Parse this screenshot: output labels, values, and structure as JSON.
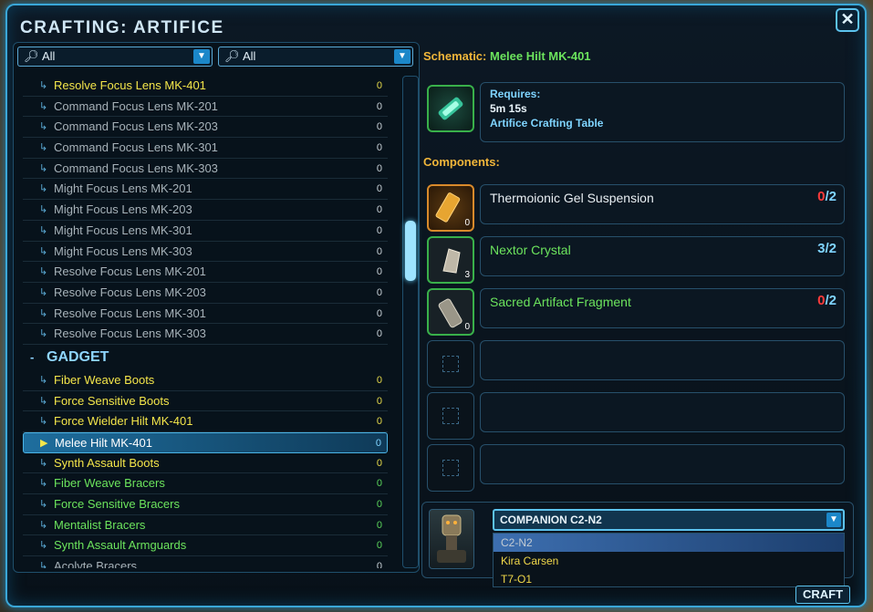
{
  "window": {
    "title": "CRAFTING: ARTIFICE",
    "close_label": "✕"
  },
  "filters": [
    {
      "value": "All",
      "icon": "search-icon"
    },
    {
      "value": "All",
      "icon": "search-icon"
    }
  ],
  "list_items": [
    {
      "label": "Resolve Focus Lens MK-401",
      "count": "0",
      "color": "yellow"
    },
    {
      "label": "Command Focus Lens MK-201",
      "count": "0",
      "color": "gray"
    },
    {
      "label": "Command Focus Lens MK-203",
      "count": "0",
      "color": "gray"
    },
    {
      "label": "Command Focus Lens MK-301",
      "count": "0",
      "color": "gray"
    },
    {
      "label": "Command Focus Lens MK-303",
      "count": "0",
      "color": "gray"
    },
    {
      "label": "Might Focus Lens MK-201",
      "count": "0",
      "color": "gray"
    },
    {
      "label": "Might Focus Lens MK-203",
      "count": "0",
      "color": "gray"
    },
    {
      "label": "Might Focus Lens MK-301",
      "count": "0",
      "color": "gray"
    },
    {
      "label": "Might Focus Lens MK-303",
      "count": "0",
      "color": "gray"
    },
    {
      "label": "Resolve Focus Lens MK-201",
      "count": "0",
      "color": "gray"
    },
    {
      "label": "Resolve Focus Lens MK-203",
      "count": "0",
      "color": "gray"
    },
    {
      "label": "Resolve Focus Lens MK-301",
      "count": "0",
      "color": "gray"
    },
    {
      "label": "Resolve Focus Lens MK-303",
      "count": "0",
      "color": "gray"
    }
  ],
  "category": {
    "label": "GADGET",
    "toggle": "-"
  },
  "gadget_items": [
    {
      "label": "Fiber Weave Boots",
      "count": "0",
      "color": "yellow"
    },
    {
      "label": "Force Sensitive Boots",
      "count": "0",
      "color": "yellow"
    },
    {
      "label": "Force Wielder Hilt MK-401",
      "count": "0",
      "color": "yellow"
    },
    {
      "label": "Melee Hilt MK-401",
      "count": "0",
      "color": "selected"
    },
    {
      "label": "Synth Assault Boots",
      "count": "0",
      "color": "yellow"
    },
    {
      "label": "Fiber Weave Bracers",
      "count": "0",
      "color": "green"
    },
    {
      "label": "Force Sensitive Bracers",
      "count": "0",
      "color": "green"
    },
    {
      "label": "Mentalist Bracers",
      "count": "0",
      "color": "green"
    },
    {
      "label": "Synth Assault Armguards",
      "count": "0",
      "color": "green"
    },
    {
      "label": "Acolyte Bracers",
      "count": "0",
      "color": "gray"
    }
  ],
  "schematic": {
    "key": "Schematic:",
    "value": "Melee Hilt MK-401"
  },
  "requires": {
    "label": "Requires:",
    "time": "5m 15s",
    "station": "Artifice Crafting Table"
  },
  "components_title": "Components:",
  "components": [
    {
      "name": "Thermoionic Gel Suspension",
      "owned": "0",
      "need": "2",
      "qty": "0",
      "name_color": "white",
      "owned_color": "red"
    },
    {
      "name": "Nextor Crystal",
      "owned": "3",
      "need": "2",
      "qty": "3",
      "name_color": "green",
      "owned_color": "blue"
    },
    {
      "name": "Sacred Artifact Fragment",
      "owned": "0",
      "need": "2",
      "qty": "0",
      "name_color": "green",
      "owned_color": "red"
    }
  ],
  "companion": {
    "selected": "COMPANION C2-N2",
    "options": [
      "C2-N2",
      "Kira Carsen",
      "T7-O1"
    ]
  },
  "craft_label": "CRAFT",
  "colors": {
    "accent": "#3aa7d8",
    "yellow": "#f4e64a",
    "green": "#6ce45d",
    "orange": "#f1b63a",
    "red": "#ff3b3b"
  }
}
